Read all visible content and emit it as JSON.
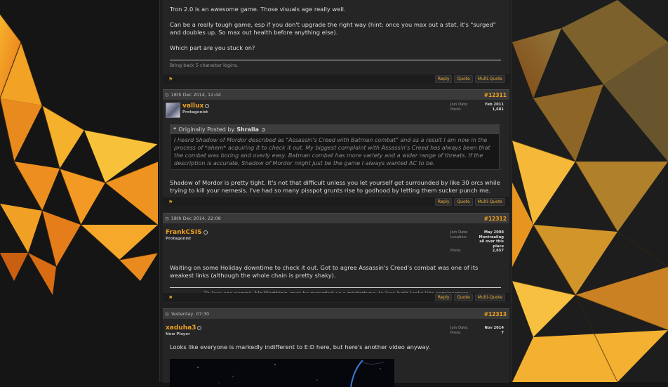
{
  "post_top": {
    "message": [
      "Tron 2.0 is an awesome game. Those visuals age really well.",
      "Can be a really tough game, esp if you don't upgrade the right way (hint: once you max out a stat, it's \"surged\" and doubles up. So max out health before anything else).",
      "Which part are you stuck on?"
    ],
    "signature": "Bring back 5 character logins."
  },
  "actions": {
    "reply": "Reply",
    "quote": "Quote",
    "multiquote": "Multi-Quote"
  },
  "post_12311": {
    "date": "18th Dec 2014, 12:44",
    "number": "#12311",
    "username": "vallux",
    "usertitle": "Protagonist",
    "join_label": "Join Date:",
    "join_value": "Feb 2011",
    "posts_label": "Posts:",
    "posts_value": "1,681",
    "quote_prefix": "Originally Posted by",
    "quote_author": "Shralla",
    "quote_text": "I heard Shadow of Mordor described as \"Assassin's Creed with Batman combat\" and as a result I am now in the process of *ahem* acquiring it to check it out. My biggest complaint with Assassin's Creed has always been that the combat was boring and overly easy. Batman combat has more variety and a wider range of threats. If the description is accurate, Shadow of Mordor might just be the game I always wanted AC to be.",
    "message": "Shadow of Mordor is pretty tight. It's not that difficult unless you let yourself get surrounded by like 30 orcs while trying to kill your nemesis. I've had so many pisspot grunts rise to godhood by letting them sucker punch me."
  },
  "post_12312": {
    "date": "18th Dec 2014, 22:08",
    "number": "#12312",
    "username": "FrankCSIS",
    "usertitle": "Protagonist",
    "join_label": "Join Date:",
    "join_value": "May 2008",
    "location_label": "Location:",
    "location_value": "Montrealing all over this place",
    "posts_label": "Posts:",
    "posts_value": "2,657",
    "message": "Waiting on some Holiday downtime to check it out. Got to agree Assassin's Creed's combat was one of its weakest links (although the whole chain is pretty shaky).",
    "signature": "To lose one parent, Mr Worthing, may be regarded as a misfortune; to lose both looks like carelessness"
  },
  "post_12313": {
    "date": "Yesterday, 07:30",
    "number": "#12313",
    "username": "xaduha3",
    "usertitle": "New Player",
    "join_label": "Join Date:",
    "join_value": "Nov 2014",
    "posts_label": "Posts:",
    "posts_value": "7",
    "message": "Looks like everyone is markedly indifferent to E:D here, but here's another video anyway."
  },
  "icons": {
    "flag": "flag-icon",
    "clock": "clock-icon",
    "online": "offline-status-icon",
    "quote": "quote-icon",
    "view_post": "view-post-icon"
  }
}
